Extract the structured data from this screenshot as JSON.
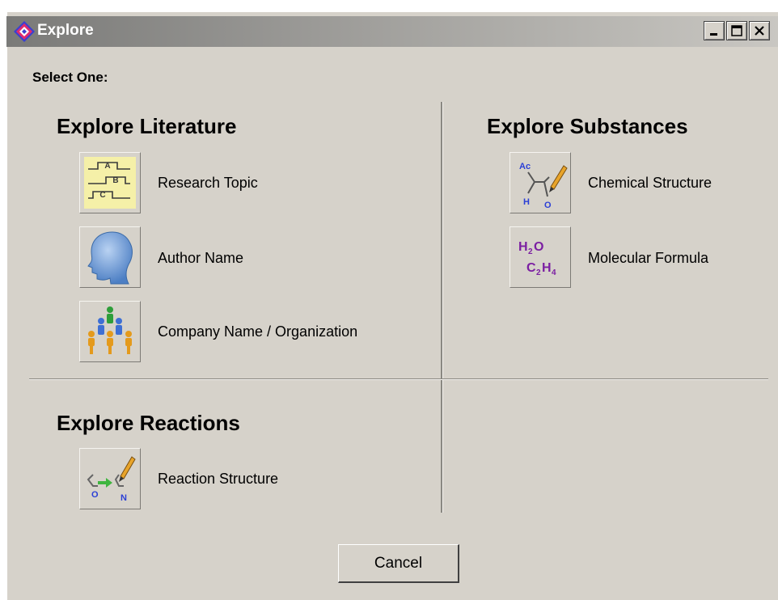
{
  "window": {
    "title": "Explore",
    "controls": {
      "minimize_icon": "minimize-icon",
      "maximize_icon": "maximize-icon",
      "close_icon": "close-icon"
    }
  },
  "prompt": "Select One:",
  "sections": {
    "literature": {
      "title": "Explore Literature",
      "options": [
        {
          "label": "Research Topic",
          "icon": "research-topic-icon"
        },
        {
          "label": "Author Name",
          "icon": "author-head-icon"
        },
        {
          "label": "Company Name / Organization",
          "icon": "people-group-icon"
        }
      ]
    },
    "substances": {
      "title": "Explore Substances",
      "options": [
        {
          "label": "Chemical Structure",
          "icon": "chemical-structure-icon"
        },
        {
          "label": "Molecular Formula",
          "icon": "molecular-formula-icon"
        }
      ]
    },
    "reactions": {
      "title": "Explore Reactions",
      "options": [
        {
          "label": "Reaction Structure",
          "icon": "reaction-structure-icon"
        }
      ]
    }
  },
  "icon_text": {
    "topic_a": "A",
    "topic_b": "B",
    "topic_c": "C",
    "chem_ac": "Ac",
    "chem_h": "H",
    "chem_o": "O",
    "formula_h": "H",
    "formula_2a": "2",
    "formula_o": "O",
    "formula_c": "C",
    "formula_2b": "2",
    "formula_h2": "H",
    "formula_4": "4",
    "rxn_o": "O",
    "rxn_n": "N"
  },
  "footer": {
    "cancel_label": "Cancel"
  },
  "colors": {
    "window_bg": "#d6d2ca",
    "formula_purple": "#7b1fa2",
    "atom_blue": "#2b3fd6"
  }
}
